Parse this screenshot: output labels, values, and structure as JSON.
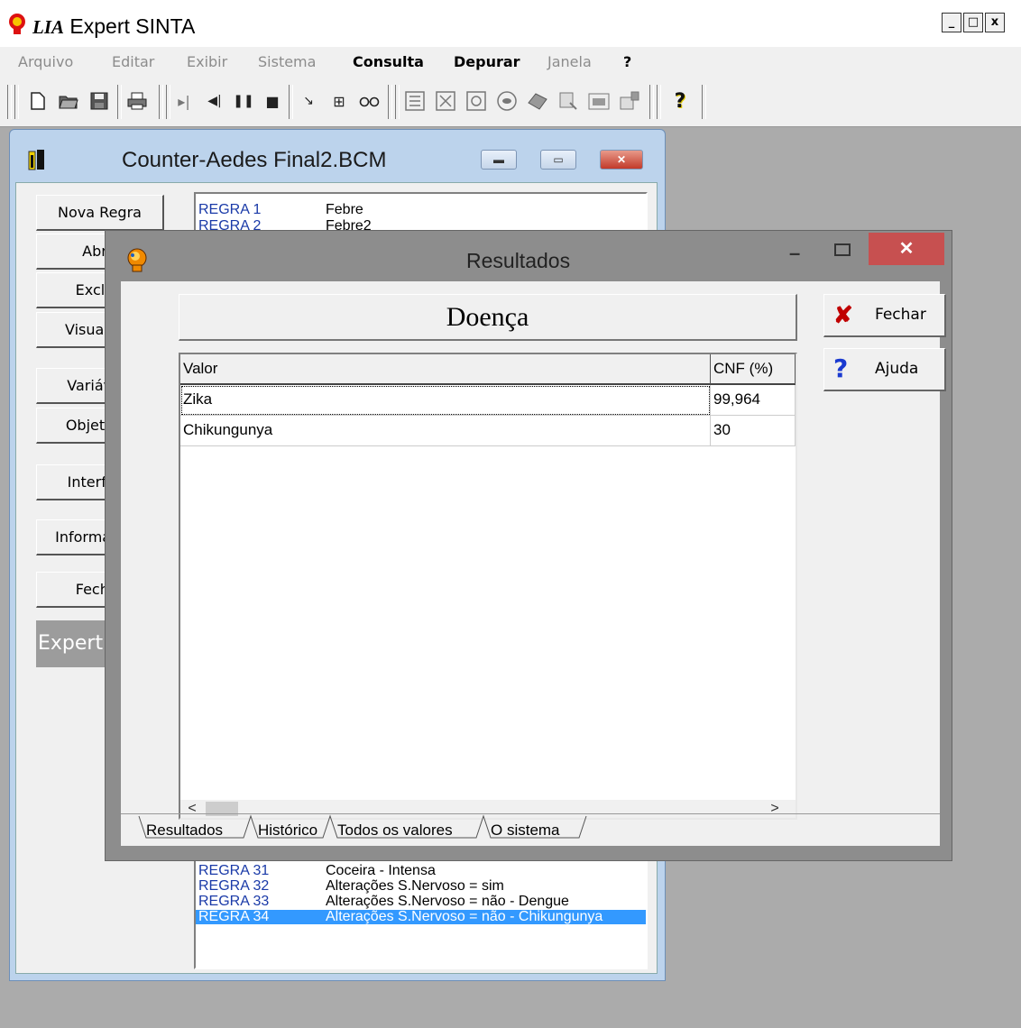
{
  "app": {
    "title_lia": "LIA",
    "title_rest": "Expert SINTA",
    "window_controls": {
      "minimize": "_",
      "maximize": "□",
      "close": "x"
    }
  },
  "menu": {
    "items": [
      {
        "label": "Arquivo",
        "enabled": false
      },
      {
        "label": "Editar",
        "enabled": false
      },
      {
        "label": "Exibir",
        "enabled": false
      },
      {
        "label": "Sistema",
        "enabled": false
      },
      {
        "label": "Consulta",
        "enabled": true
      },
      {
        "label": "Depurar",
        "enabled": true
      },
      {
        "label": "Janela",
        "enabled": false
      },
      {
        "label": "?",
        "enabled": true
      }
    ]
  },
  "toolbar": {
    "icons": [
      "new-file-icon",
      "open-file-icon",
      "save-icon",
      "print-icon",
      "step-icon",
      "back-icon",
      "pause-icon",
      "stop-icon",
      "cursor-icon",
      "expand-icon",
      "glasses-icon",
      "rules-icon",
      "variables-icon",
      "objectives-icon",
      "interface-icon",
      "info-icon",
      "window-icon",
      "report-icon",
      "help-icon"
    ],
    "help_glyph": "?"
  },
  "child": {
    "title": "Counter-Aedes Final2.BCM",
    "buttons": [
      {
        "label": "Nova Regra"
      },
      {
        "label": "Abrir"
      },
      {
        "label": "Excluir"
      },
      {
        "label": "Visualizar"
      },
      {
        "label": "Variáveis"
      },
      {
        "label": "Objetivos"
      },
      {
        "label": "Interface"
      },
      {
        "label": "Informações"
      },
      {
        "label": "Fechar"
      }
    ],
    "expert_label": "Expert",
    "rules": [
      {
        "id": "REGRA  1",
        "text": "Febre",
        "selected": false
      },
      {
        "id": "REGRA  2",
        "text": "Febre2",
        "selected": false
      },
      {
        "id": "REGRA  31",
        "text": "Coceira - Intensa",
        "selected": false
      },
      {
        "id": "REGRA  32",
        "text": "Alterações S.Nervoso = sim",
        "selected": false
      },
      {
        "id": "REGRA  33",
        "text": "Alterações S.Nervoso = não - Dengue",
        "selected": false
      },
      {
        "id": "REGRA  34",
        "text": "Alterações S.Nervoso = não - Chikungunya",
        "selected": true
      }
    ]
  },
  "dialog": {
    "title": "Resultados",
    "close_glyph": "✕",
    "header": "Doença",
    "columns": {
      "value": "Valor",
      "cnf": "CNF (%)"
    },
    "rows": [
      {
        "value": "Zika",
        "cnf": "99,964"
      },
      {
        "value": "Chikungunya",
        "cnf": "30"
      }
    ],
    "scroll": {
      "left": "<",
      "right": ">"
    },
    "buttons": {
      "close": {
        "label": "Fechar",
        "icon": "✘"
      },
      "help": {
        "label": "Ajuda",
        "icon": "?"
      }
    },
    "tabs": [
      "Resultados",
      "Histórico",
      "Todos os valores",
      "O sistema"
    ]
  },
  "colors": {
    "workspace": "#ababab",
    "selection": "#3399ff",
    "rule_id": "#1a3aa8",
    "close_red": "#c75050",
    "fechar_icon": "#c00000",
    "ajuda_icon": "#1a3ad0"
  }
}
